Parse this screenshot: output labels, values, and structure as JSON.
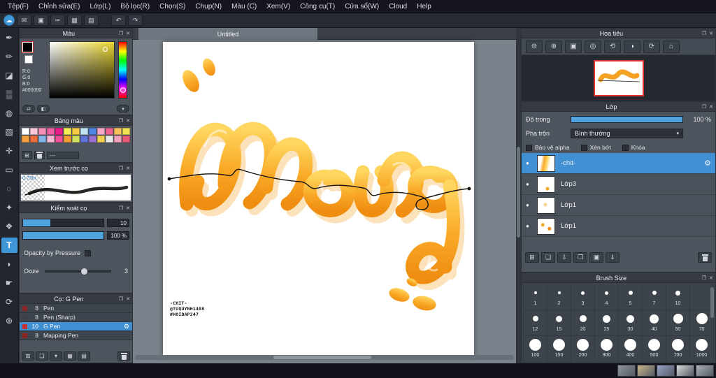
{
  "chrome": {
    "float_glyph": "❐",
    "close_glyph": "✕",
    "dropdown_glyph": "▾",
    "eye_glyph": "●",
    "gear_glyph": "⚙",
    "swap_glyph": "⇄",
    "reset_colors_glyph": "◧",
    "menu_glyph": "▾"
  },
  "colors": {
    "accent": "#3f97d8",
    "selection": "#4190d3",
    "slider_fill": "#4fa3de",
    "navigator_border": "#e23333"
  },
  "menubar": {
    "items": [
      "Tệp(F)",
      "Chỉnh sửa(E)",
      "Lớp(L)",
      "Bộ lọc(R)",
      "Chọn(S)",
      "Chụp(N)",
      "Màu (C)",
      "Xem(V)",
      "Công cụ(T)",
      "Cửa sổ(W)",
      "Cloud",
      "Help"
    ]
  },
  "toolbar": {
    "icons": [
      {
        "name": "medibang-cloud-icon",
        "glyph": "☁",
        "round": true
      },
      {
        "name": "comment-icon",
        "glyph": "✉"
      },
      {
        "name": "panel-layout-icon",
        "glyph": "▣"
      },
      {
        "name": "brush-edit-icon",
        "glyph": "✑"
      },
      {
        "name": "grid-view-icon",
        "glyph": "▦"
      },
      {
        "name": "material-panel-icon",
        "glyph": "▤"
      },
      {
        "name": "toolbar-divider",
        "divider": true
      },
      {
        "name": "undo-icon",
        "glyph": "↶"
      },
      {
        "name": "redo-icon",
        "glyph": "↷"
      }
    ]
  },
  "toolstrip": {
    "tools": [
      {
        "name": "pen-tool",
        "glyph": "✒"
      },
      {
        "name": "pencil-tool",
        "glyph": "✏"
      },
      {
        "name": "eraser-tool",
        "glyph": "◪"
      },
      {
        "name": "airbrush-tool",
        "glyph": "▒"
      },
      {
        "name": "fill-tool",
        "glyph": "◍"
      },
      {
        "name": "gradient-tool",
        "glyph": "▧"
      },
      {
        "name": "move-tool",
        "glyph": "✛"
      },
      {
        "name": "select-tool",
        "glyph": "▭"
      },
      {
        "name": "lasso-tool",
        "glyph": "◌"
      },
      {
        "name": "magic-wand-tool",
        "glyph": "✦"
      },
      {
        "name": "shape-tool",
        "glyph": "❖"
      },
      {
        "name": "text-tool",
        "glyph": "T",
        "active": true
      },
      {
        "name": "eyedropper-tool",
        "glyph": "◗"
      },
      {
        "name": "hand-tool",
        "glyph": "☛"
      },
      {
        "name": "rotate-view-tool",
        "glyph": "⟳"
      },
      {
        "name": "zoom-tool",
        "glyph": "⊕"
      }
    ]
  },
  "color_panel": {
    "title": "Màu",
    "r": "R:0",
    "g": "G:0",
    "b": "B:0",
    "hex": "#000000"
  },
  "palette_panel": {
    "title": "Bảng màu",
    "preset_label": "---",
    "rows": [
      [
        "#ffffff",
        "#f8c8d8",
        "#f490b8",
        "#ef5fa2",
        "#ea1f8e",
        "#f5ee55",
        "#f6c945",
        "#c2e4f2",
        "#4f86e8",
        "#f8a9c9",
        "#ef6494",
        "#f8c15c",
        "#f2e152"
      ],
      [
        "#f5a03e",
        "#ee6d3b",
        "#82b5ea",
        "#f6b9d1",
        "#ee5099",
        "#f59f31",
        "#d0e15c",
        "#6075da",
        "#9b70d2",
        "#f2d04b",
        "#e9e9e9",
        "#f1a1b9",
        "#e95b79"
      ]
    ]
  },
  "preview_panel": {
    "title": "Xem trước cọ",
    "scale_label": "0.73m"
  },
  "control_panel": {
    "title": "Kiểm soát cọ",
    "size_value": "10",
    "opacity_value": "100 %",
    "pressure_label": "Opacity by Pressure",
    "ooze_label": "Ooze",
    "ooze_value": "3"
  },
  "brush_panel": {
    "title": "Cọ: G Pen",
    "brushes": [
      {
        "size": "8",
        "name": "Pen",
        "tag": "#8a2626"
      },
      {
        "size": "8",
        "name": "Pen (Sharp)",
        "tag": "#3a3f46"
      },
      {
        "size": "10",
        "name": "G Pen",
        "tag": "#c23030",
        "selected": true
      },
      {
        "size": "8",
        "name": "Mapping Pen",
        "tag": "#8a2626"
      }
    ],
    "footer_icons": [
      {
        "name": "add-brush-icon",
        "glyph": "⊞"
      },
      {
        "name": "duplicate-brush-icon",
        "glyph": "❏"
      },
      {
        "name": "brush-menu-icon",
        "glyph": "▾"
      },
      {
        "name": "brush-grid-view-icon",
        "glyph": "▦"
      },
      {
        "name": "brush-list-view-icon",
        "glyph": "▤"
      },
      {
        "name": "delete-brush-icon",
        "trash": true
      }
    ]
  },
  "canvas": {
    "tab_label": "Untitled",
    "credits": [
      "-CHIT-",
      "@TUQUYNH1408",
      "#HOIDAP247"
    ]
  },
  "navigator": {
    "title": "Hoa tiêu",
    "icons": [
      {
        "name": "zoom-out-icon",
        "glyph": "⊖"
      },
      {
        "name": "zoom-in-icon",
        "glyph": "⊕"
      },
      {
        "name": "fit-screen-icon",
        "glyph": "▣"
      },
      {
        "name": "zoom-100-icon",
        "glyph": "◎"
      },
      {
        "name": "rotate-left-icon",
        "glyph": "⟲"
      },
      {
        "name": "flip-view-icon",
        "glyph": "◑"
      },
      {
        "name": "rotate-right-icon",
        "glyph": "⟳"
      },
      {
        "name": "reset-view-icon",
        "glyph": "⌂"
      }
    ]
  },
  "layer_panel": {
    "title": "Lớp",
    "opacity_label": "Độ trong",
    "opacity_value": "100 %",
    "blend_label": "Pha trộn",
    "blend_value": "Bình thường",
    "protect_alpha_label": "Bảo vệ alpha",
    "clip_label": "Xén bớt",
    "lock_label": "Khóa",
    "layers": [
      {
        "name": "-chit-",
        "selected": true
      },
      {
        "name": "Lớp3"
      },
      {
        "name": "Lớp1"
      },
      {
        "name": "Lớp1"
      }
    ],
    "footer_icons": [
      {
        "name": "new-layer-icon",
        "glyph": "⊞"
      },
      {
        "name": "duplicate-layer-icon",
        "glyph": "❏"
      },
      {
        "name": "layer-down-icon",
        "glyph": "⇩"
      },
      {
        "name": "layer-folder-icon",
        "glyph": "❐"
      },
      {
        "name": "layer-material-icon",
        "glyph": "▣"
      },
      {
        "name": "merge-layer-icon",
        "glyph": "⇓"
      },
      {
        "name": "delete-layer-icon",
        "trash": true
      }
    ]
  },
  "brush_size_panel": {
    "title": "Brush Size",
    "rows": [
      [
        "1",
        "2",
        "3",
        "4",
        "5",
        "7",
        "10"
      ],
      [
        "12",
        "15",
        "20",
        "25",
        "30",
        "40",
        "50",
        "70"
      ],
      [
        "100",
        "150",
        "200",
        "300",
        "400",
        "500",
        "700",
        "1000"
      ]
    ]
  },
  "bottombar": {
    "thumbnails": [
      "#8d949c",
      "#c9b489",
      "#97a0c9",
      "#d6d7d9",
      "#a9b0b8"
    ]
  }
}
